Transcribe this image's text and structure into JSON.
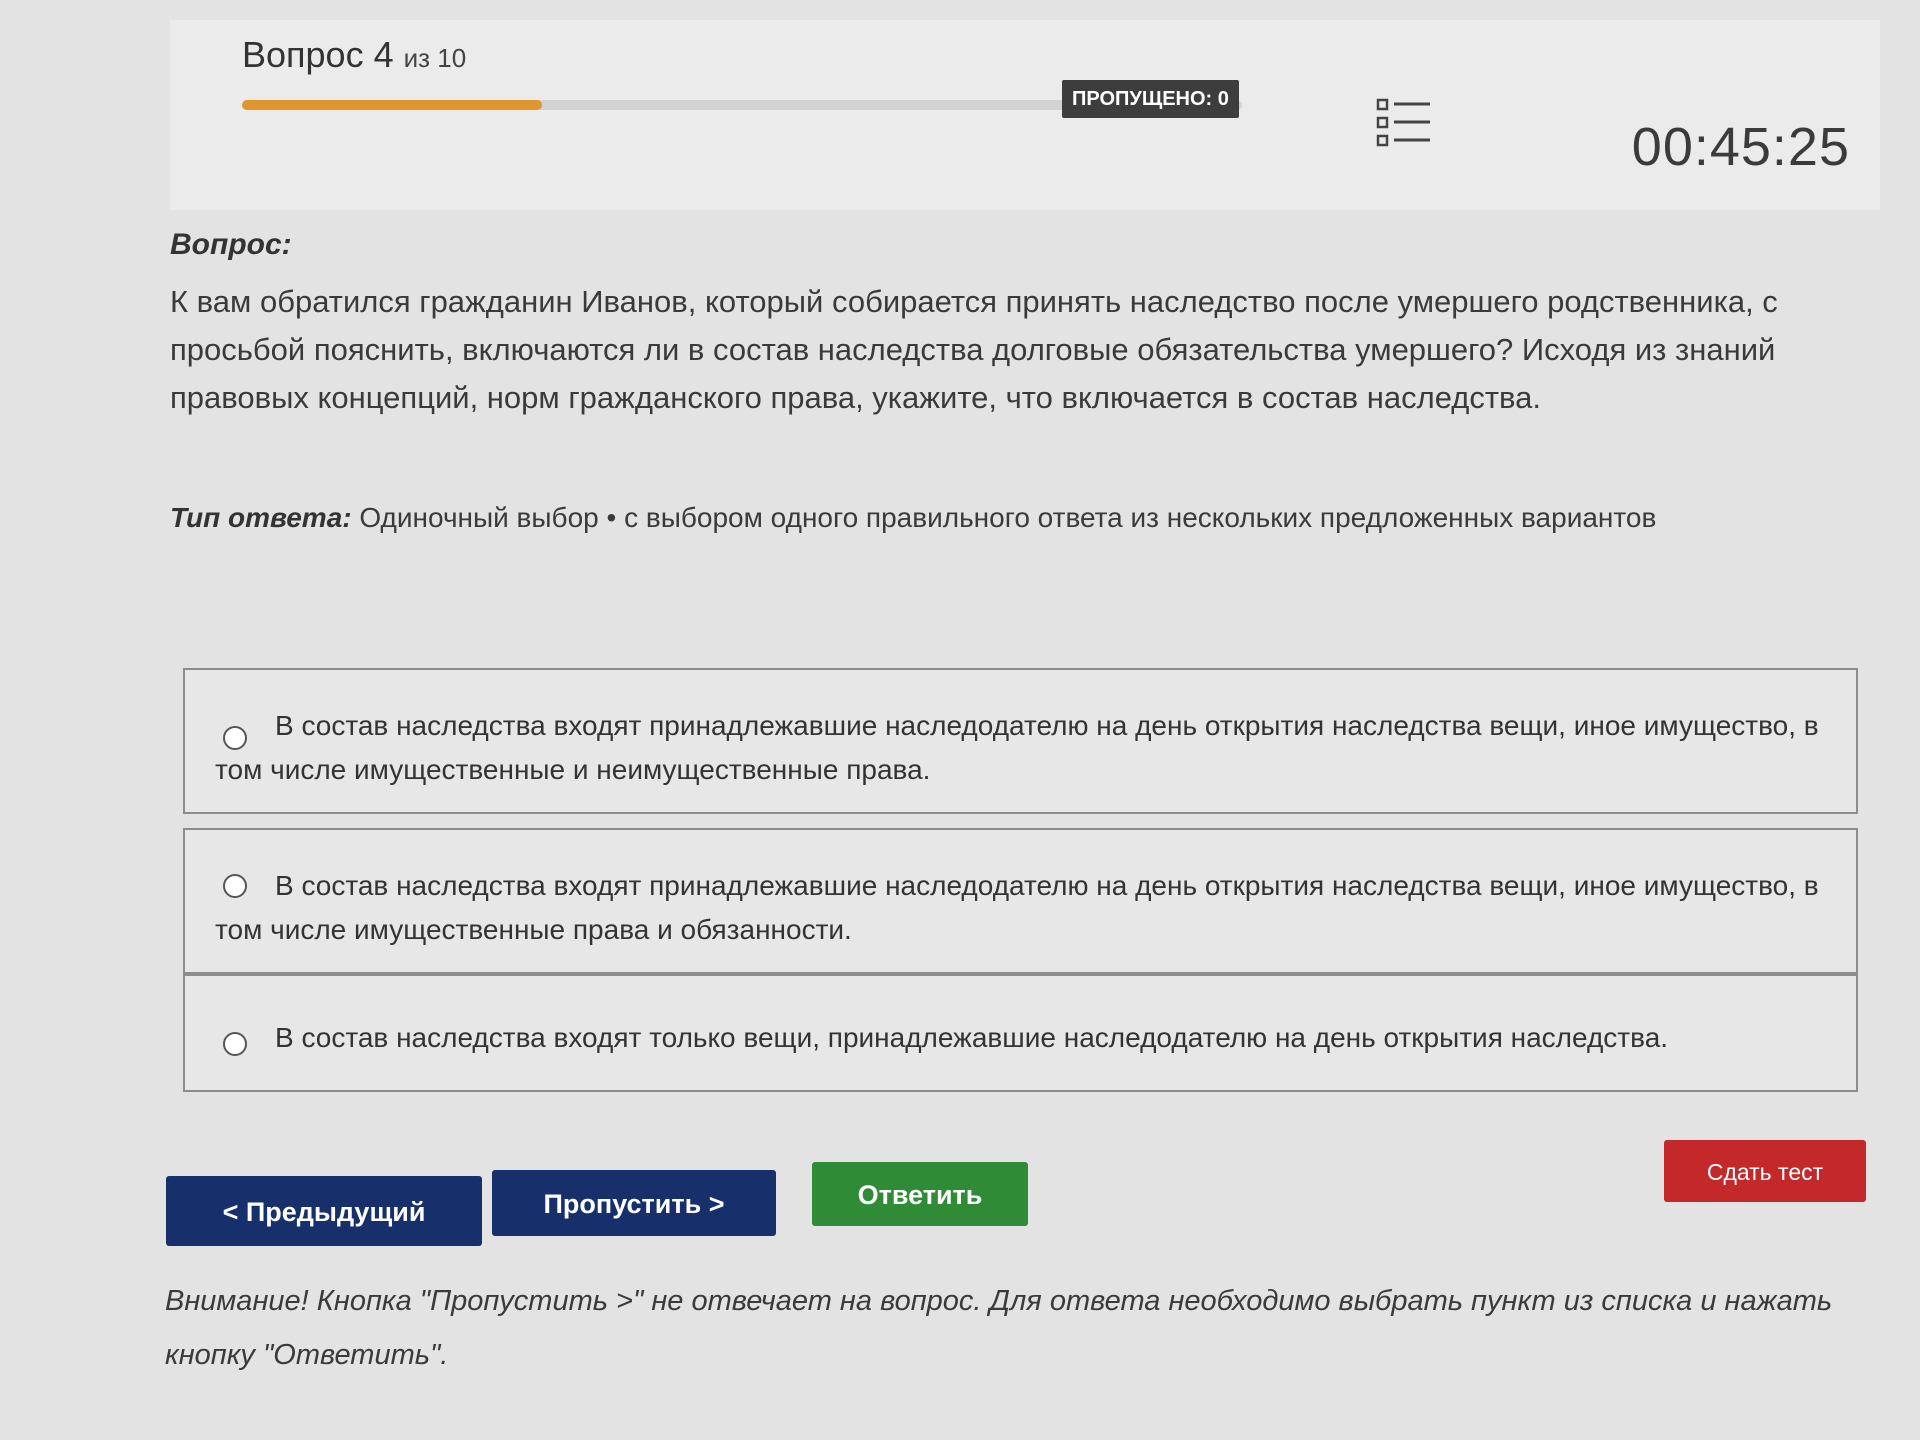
{
  "header": {
    "question_word": "Вопрос",
    "question_number": "4",
    "question_of": "из 10",
    "progress": 0.3,
    "skipped_label": "ПРОПУЩЕНО: 0",
    "timer": "00:45:25",
    "list_icon": "list-icon"
  },
  "question": {
    "label": "Вопрос:",
    "text": "К вам обратился гражданин Иванов, который собирается принять наследство после умершего родственника, с просьбой пояснить, включаются ли в состав наследства долговые обязательства умершего? Исходя из знаний правовых концепций, норм гражданского права, укажите, что включается в состав наследства."
  },
  "answer_type": {
    "label": "Тип ответа:",
    "value": "Одиночный выбор • с выбором одного правильного ответа из нескольких предложенных вариантов"
  },
  "options": [
    {
      "text": "В состав наследства входят принадлежавшие наследодателю на день открытия наследства вещи, иное имущество, в том числе имущественные и неимущественные права."
    },
    {
      "text": "В состав наследства входят принадлежавшие наследодателю на день открытия наследства вещи, иное имущество, в том числе имущественные права и обязанности."
    },
    {
      "text": "В состав наследства входят только вещи, принадлежавшие наследодателю на день открытия наследства."
    }
  ],
  "buttons": {
    "prev": "< Предыдущий",
    "skip": "Пропустить >",
    "answer": "Ответить",
    "submit": "Сдать тест"
  },
  "warning": "Внимание! Кнопка \"Пропустить >\" не отвечает на вопрос. Для ответа необходимо выбрать пункт из списка и нажать кнопку \"Ответить\".",
  "colors": {
    "progress": "#e0952f",
    "nav_button": "#17306b",
    "answer_button": "#2f8b35",
    "submit_button": "#c3282a"
  }
}
